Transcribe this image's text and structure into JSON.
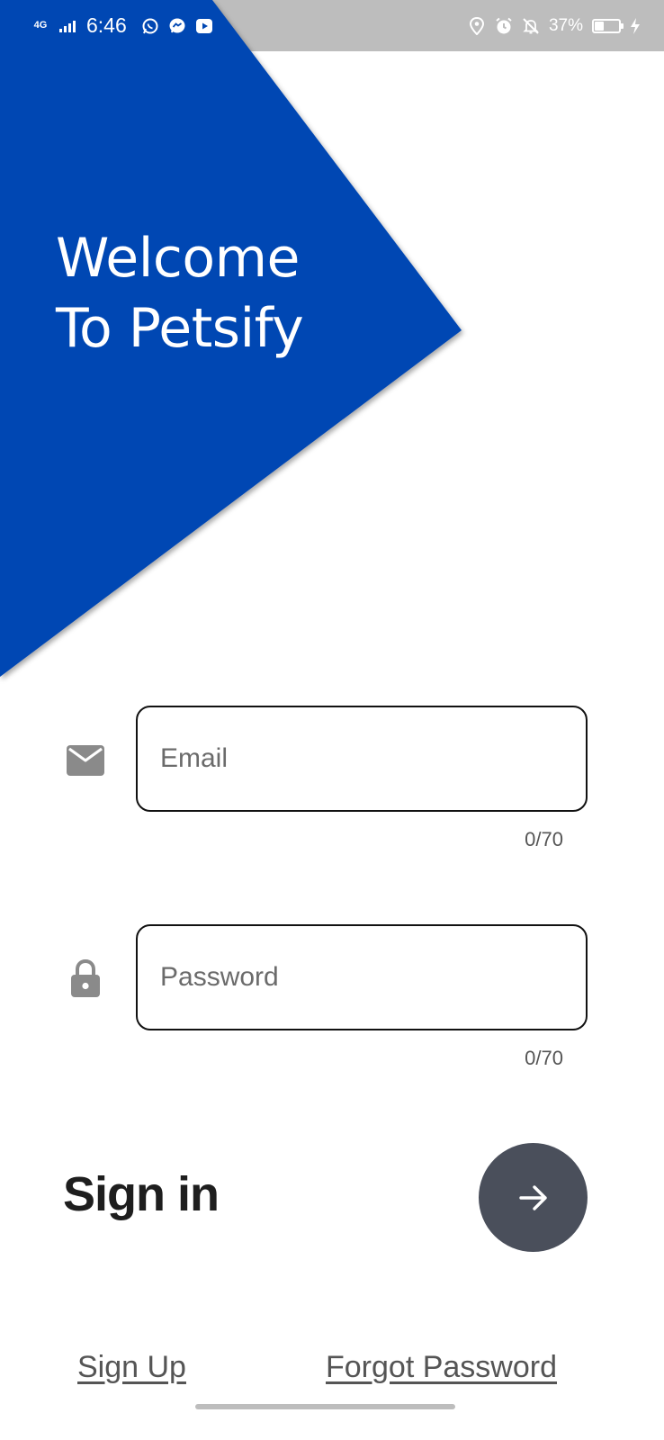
{
  "status_bar": {
    "network_type": "4G",
    "time": "6:46",
    "battery_percent": "37%",
    "battery_level": 0.37,
    "left_icons": [
      "network-4g-icon",
      "signal-icon",
      "whatsapp-icon",
      "messenger-icon",
      "youtube-icon"
    ],
    "right_icons": [
      "location-icon",
      "alarm-icon",
      "notifications-off-icon",
      "battery-icon",
      "charging-icon"
    ]
  },
  "hero": {
    "line1": "Welcome",
    "line2": "To Petsify",
    "color": "#0047b3"
  },
  "form": {
    "email": {
      "placeholder": "Email",
      "value": "",
      "counter": "0/70",
      "icon": "email-icon"
    },
    "password": {
      "placeholder": "Password",
      "value": "",
      "counter": "0/70",
      "icon": "lock-icon"
    },
    "signin_label": "Sign in",
    "signin_button_icon": "arrow-right-icon",
    "signin_button_color": "#4a4f5b"
  },
  "links": {
    "sign_up": "Sign Up",
    "forgot_password": "Forgot Password"
  }
}
